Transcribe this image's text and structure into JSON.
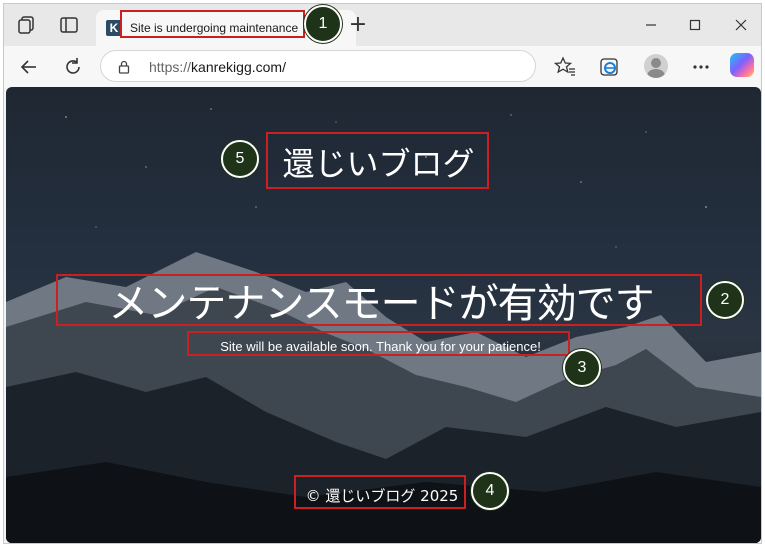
{
  "browser": {
    "tab": {
      "title": "Site is undergoing maintenance",
      "favicon_letter": "K"
    },
    "new_tab_symbol": "+",
    "address": {
      "scheme": "https://",
      "host": "kanrekigg.com/"
    },
    "icons": {
      "workspaces": "workspaces-icon",
      "tab_actions": "tab-actions-icon",
      "new_tab": "plus-icon",
      "minimize": "minimize-icon",
      "maximize": "maximize-icon",
      "close": "close-icon",
      "back": "back-arrow-icon",
      "refresh": "refresh-icon",
      "lock": "lock-icon",
      "favorites": "favorites-icon",
      "edge_collections": "edge-icon",
      "profile": "profile-avatar-icon",
      "more": "more-icon",
      "copilot": "copilot-icon"
    }
  },
  "page": {
    "site_name": "還じいブログ",
    "headline": "メンテナンスモードが有効です",
    "subline": "Site will be available soon. Thank you for your patience!",
    "footer": "© 還じいブログ 2025"
  },
  "annotations": {
    "items": [
      {
        "number": "1",
        "target": "tab-title"
      },
      {
        "number": "2",
        "target": "headline"
      },
      {
        "number": "3",
        "target": "subline"
      },
      {
        "number": "4",
        "target": "footer"
      },
      {
        "number": "5",
        "target": "site-name"
      }
    ],
    "box_color": "#cc1f1f",
    "badge_color": "#1f3318"
  }
}
